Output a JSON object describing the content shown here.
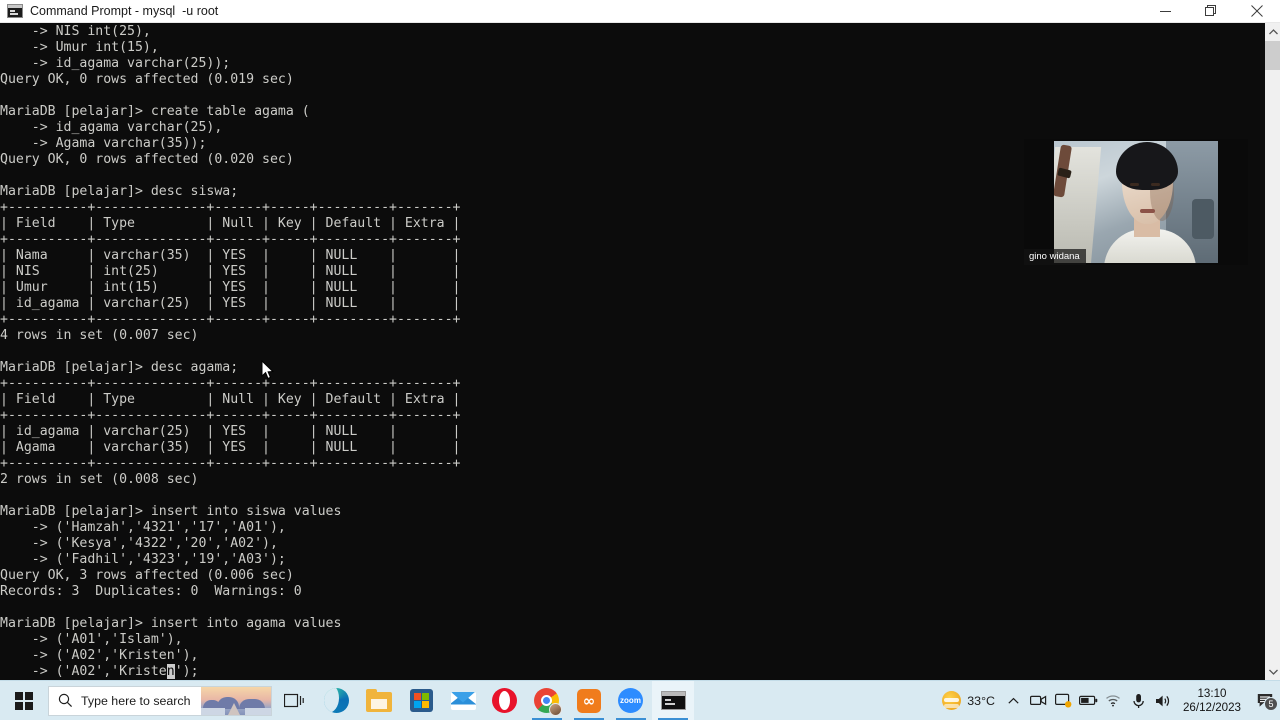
{
  "window": {
    "title": "Command Prompt - mysql  -u root",
    "icon": "cmd-icon",
    "controls": {
      "minimize": "minimize-button",
      "restore": "restore-button",
      "close": "close-button"
    }
  },
  "console": {
    "text": "    -> NIS int(25),\n    -> Umur int(15),\n    -> id_agama varchar(25));\nQuery OK, 0 rows affected (0.019 sec)\n\nMariaDB [pelajar]> create table agama (\n    -> id_agama varchar(25),\n    -> Agama varchar(35));\nQuery OK, 0 rows affected (0.020 sec)\n\nMariaDB [pelajar]> desc siswa;\n+----------+--------------+------+-----+---------+-------+\n| Field    | Type         | Null | Key | Default | Extra |\n+----------+--------------+------+-----+---------+-------+\n| Nama     | varchar(35)  | YES  |     | NULL    |       |\n| NIS      | int(25)      | YES  |     | NULL    |       |\n| Umur     | int(15)      | YES  |     | NULL    |       |\n| id_agama | varchar(25)  | YES  |     | NULL    |       |\n+----------+--------------+------+-----+---------+-------+\n4 rows in set (0.007 sec)\n\nMariaDB [pelajar]> desc agama;\n+----------+--------------+------+-----+---------+-------+\n| Field    | Type         | Null | Key | Default | Extra |\n+----------+--------------+------+-----+---------+-------+\n| id_agama | varchar(25)  | YES  |     | NULL    |       |\n| Agama    | varchar(35)  | YES  |     | NULL    |       |\n+----------+--------------+------+-----+---------+-------+\n2 rows in set (0.008 sec)\n\nMariaDB [pelajar]> insert into siswa values\n    -> ('Hamzah','4321','17','A01'),\n    -> ('Kesya','4322','20','A02'),\n    -> ('Fadhil','4323','19','A03');\nQuery OK, 3 rows affected (0.006 sec)\nRecords: 3  Duplicates: 0  Warnings: 0\n\nMariaDB [pelajar]> insert into agama values\n    -> ('A01','Islam'),\n    -> ('A02','Kristen'),\n    -> ('A02','Kriste",
    "cursor_char": "n",
    "tail": "');"
  },
  "webcam": {
    "label": "gino widana"
  },
  "taskbar": {
    "start": "start-button",
    "search": {
      "placeholder": "Type here to search"
    },
    "task_view": "task-view-button",
    "apps": [
      {
        "name": "microsoft-edge",
        "label": "Microsoft Edge",
        "active": false
      },
      {
        "name": "file-explorer",
        "label": "File Explorer",
        "active": false
      },
      {
        "name": "microsoft-store",
        "label": "Microsoft Store",
        "active": false
      },
      {
        "name": "mail",
        "label": "Mail",
        "active": false
      },
      {
        "name": "opera",
        "label": "Opera",
        "active": false
      },
      {
        "name": "google-chrome",
        "label": "Google Chrome",
        "active": true
      },
      {
        "name": "xampp",
        "label": "XAMPP Control Panel",
        "active": true
      },
      {
        "name": "zoom",
        "label": "Zoom",
        "active": true
      },
      {
        "name": "command-prompt",
        "label": "Command Prompt",
        "active": true
      }
    ],
    "zoom_label": "zoom",
    "xampp_label": "∞"
  },
  "tray": {
    "temperature": "33°C",
    "weather_icon": "sun-behind-cloud-icon",
    "icons": [
      "chevron-up-icon",
      "camera-icon",
      "screen-share-icon",
      "battery-icon",
      "wifi-icon",
      "microphone-icon",
      "volume-icon"
    ],
    "time": "13:10",
    "date": "26/12/2023",
    "notification_count": "5"
  },
  "scrollbar": {
    "up": "scroll-up-button",
    "down": "scroll-down-button",
    "thumb": "scroll-thumb"
  },
  "colors": {
    "taskbar_bg": "#d9eaf2",
    "console_bg": "#0c0c0c",
    "console_fg": "#ccccc8",
    "accent": "#3a8fd4"
  }
}
